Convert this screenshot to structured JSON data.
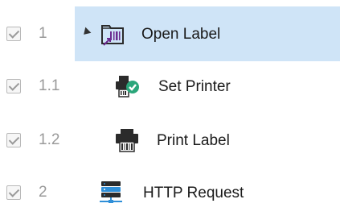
{
  "tree": {
    "items": [
      {
        "number": "1",
        "label": "Open Label",
        "checked": true,
        "selected": true,
        "expanded": true,
        "icon": "open-label-icon"
      },
      {
        "number": "1.1",
        "label": "Set Printer",
        "checked": true,
        "selected": false,
        "icon": "set-printer-icon"
      },
      {
        "number": "1.2",
        "label": "Print Label",
        "checked": true,
        "selected": false,
        "icon": "print-label-icon"
      },
      {
        "number": "2",
        "label": "HTTP Request",
        "checked": true,
        "selected": false,
        "icon": "http-request-icon"
      }
    ]
  },
  "colors": {
    "selection": "#cfe4f7",
    "check_green": "#2aa67a",
    "folder_purple": "#6b2a8f",
    "icon_dark": "#2b2b2b",
    "server_blue": "#2f8fd8"
  }
}
